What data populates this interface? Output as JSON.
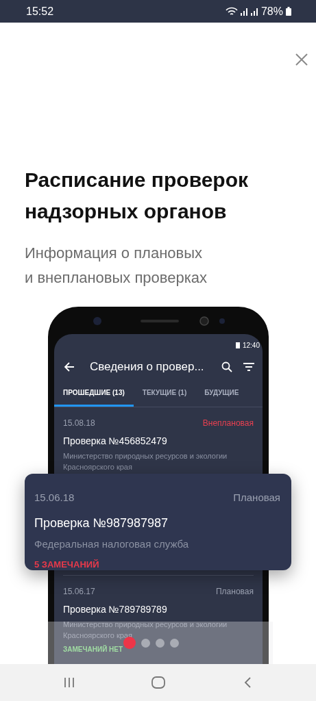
{
  "status_bar": {
    "time": "15:52",
    "battery": "78%"
  },
  "title_lines": [
    "Расписание проверок",
    "надзорных органов"
  ],
  "subtitle_lines": [
    "Информация о плановых",
    "и внеплановых проверках"
  ],
  "phone_screen": {
    "status_time": "12:40",
    "title": "Сведения о провер...",
    "tabs": [
      {
        "label": "ПРОШЕДШИЕ (13)",
        "selected": true
      },
      {
        "label": "ТЕКУЩИЕ (1)",
        "selected": false
      },
      {
        "label": "БУДУЩИЕ",
        "selected": false
      }
    ],
    "items": [
      {
        "date": "15.08.18",
        "type": {
          "label": "Внеплановая",
          "color": "#e84050"
        },
        "title": "Проверка №456852479",
        "org": "Министерство природных ресурсов и экологии Красноярского края"
      },
      {
        "date": "15.06.17",
        "type": {
          "label": "Плановая",
          "color": "#9aa0b0"
        },
        "title": "Проверка №789789789",
        "org": "Министерство природных ресурсов и экологии Красноярского края",
        "remarks": {
          "label": "ЗАМЕЧАНИЙ НЕТ",
          "color": "#a1dda3"
        }
      }
    ]
  },
  "card": {
    "date": "15.06.18",
    "type": {
      "label": "Плановая",
      "color": "#9aa0b0"
    },
    "title": "Проверка №987987987",
    "org": "Федеральная налоговая служба",
    "remarks": {
      "label": "5 ЗАМЕЧАНИЙ",
      "color": "#e8394a"
    }
  },
  "pager": [
    {
      "selected": true
    },
    {
      "selected": false
    },
    {
      "selected": false
    },
    {
      "selected": false
    }
  ]
}
